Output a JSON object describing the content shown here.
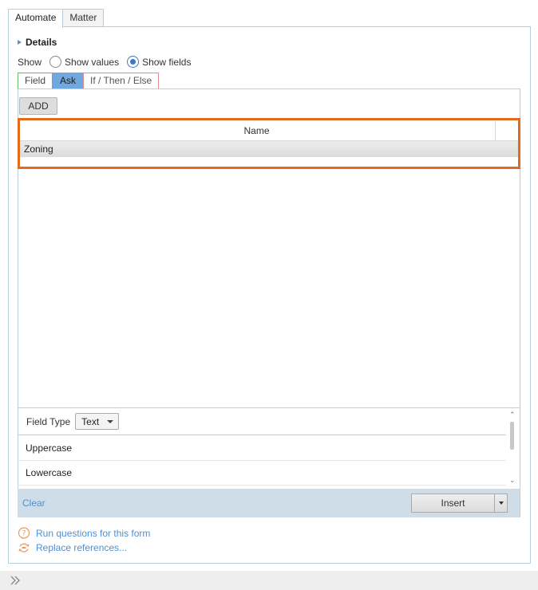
{
  "tabs": [
    {
      "label": "Automate",
      "active": true
    },
    {
      "label": "Matter",
      "active": false
    }
  ],
  "details": {
    "label": "Details"
  },
  "show": {
    "label": "Show",
    "options": [
      {
        "label": "Show values",
        "selected": false
      },
      {
        "label": "Show fields",
        "selected": true
      }
    ]
  },
  "subtabs": [
    {
      "label": "Field",
      "active": false
    },
    {
      "label": "Ask",
      "active": true
    },
    {
      "label": "If / Then / Else",
      "active": false
    }
  ],
  "ask": {
    "add_label": "ADD",
    "column_header": "Name",
    "rows": [
      "Zoning"
    ]
  },
  "format": {
    "field_type_label": "Field Type",
    "field_type_value": "Text",
    "options": [
      "Uppercase",
      "Lowercase"
    ]
  },
  "actions": {
    "clear_label": "Clear",
    "insert_label": "Insert"
  },
  "links": {
    "run_questions": "Run questions for this form",
    "replace_references": "Replace references..."
  },
  "colors": {
    "accent_blue": "#6ea8df",
    "highlight_orange": "#e26b1e",
    "link_blue": "#4a90d9",
    "icon_orange": "#e89a5c"
  },
  "icons": {
    "run_questions": "question-circle-icon",
    "replace_references": "refresh-icon",
    "expand": "double-chevron-right-icon"
  }
}
